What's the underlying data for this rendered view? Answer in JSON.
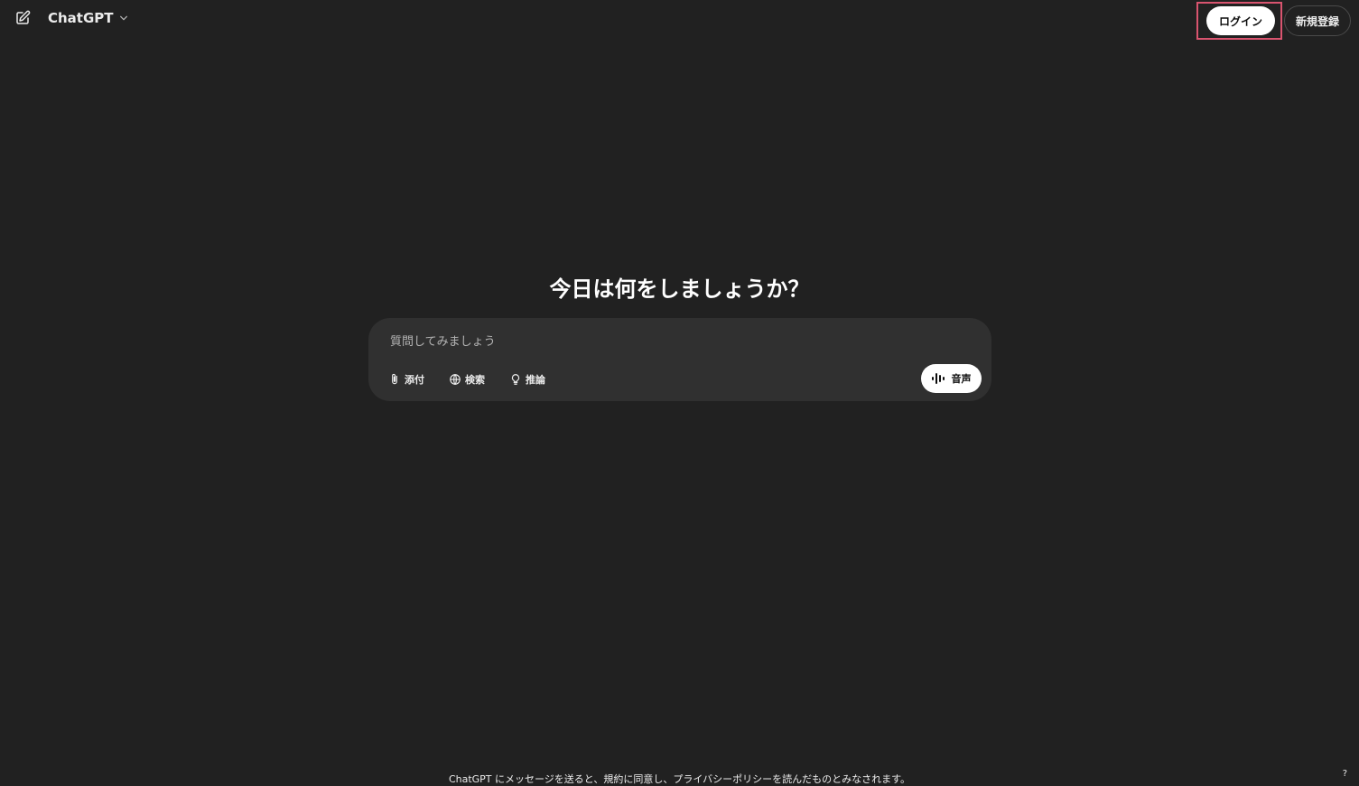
{
  "header": {
    "model_name": "ChatGPT",
    "login_label": "ログイン",
    "signup_label": "新規登録"
  },
  "main": {
    "headline": "今日は何をしましょうか？",
    "composer": {
      "placeholder": "質問してみましょう",
      "tools": [
        {
          "label": "添付",
          "icon": "paperclip-icon"
        },
        {
          "label": "検索",
          "icon": "globe-icon"
        },
        {
          "label": "推論",
          "icon": "lightbulb-icon"
        }
      ],
      "voice_label": "音声"
    }
  },
  "footer": {
    "notice": "ChatGPT にメッセージを送ると、規約に同意し、プライバシーポリシーを読んだものとみなされます。",
    "help_label": "?"
  },
  "colors": {
    "background": "#212121",
    "composer_bg": "#303030",
    "highlight_border": "#d9546f"
  }
}
